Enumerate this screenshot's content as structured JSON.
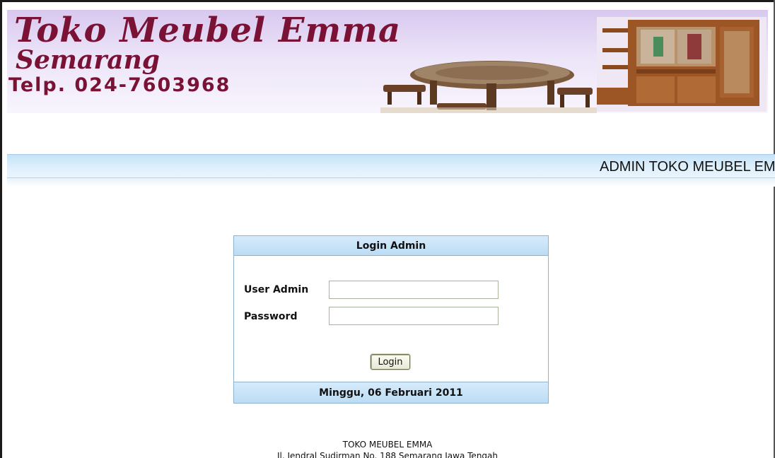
{
  "banner": {
    "title": "Toko Meubel Emma",
    "city": "Semarang",
    "phone": "Telp. 024-7603968",
    "title_color": "#7a1236",
    "background": "#e4d8f5"
  },
  "admin_bar": {
    "text": "ADMIN TOKO MEUBEL EMMA",
    "color": "#cfe7f9"
  },
  "login": {
    "header": "Login Admin",
    "user_label": "User Admin",
    "user_value": "",
    "password_label": "Password",
    "password_value": "",
    "button_label": "Login",
    "date": "Minggu, 06 Februari 2011"
  },
  "footer": {
    "store_name": "TOKO MEUBEL EMMA",
    "address": "Jl. Jendral Sudirman No. 188 Semarang Jawa Tengah"
  }
}
